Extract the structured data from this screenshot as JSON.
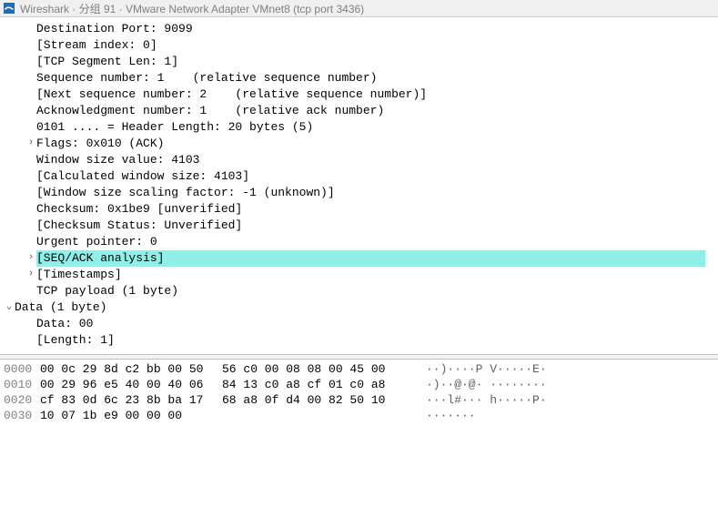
{
  "titlebar": {
    "text": "Wireshark · 分组 91 · VMware Network Adapter VMnet8 (tcp port 3436)"
  },
  "details": {
    "dst_port": "Destination Port: 9099",
    "stream_index": "[Stream index: 0]",
    "tcp_seg_len": "[TCP Segment Len: 1]",
    "seq_num": "Sequence number: 1    (relative sequence number)",
    "next_seq": "[Next sequence number: 2    (relative sequence number)]",
    "ack_num": "Acknowledgment number: 1    (relative ack number)",
    "hdr_len": "0101 .... = Header Length: 20 bytes (5)",
    "flags": "Flags: 0x010 (ACK)",
    "win_size": "Window size value: 4103",
    "calc_win": "[Calculated window size: 4103]",
    "win_scale": "[Window size scaling factor: -1 (unknown)]",
    "checksum": "Checksum: 0x1be9 [unverified]",
    "chk_status": "[Checksum Status: Unverified]",
    "urg_ptr": "Urgent pointer: 0",
    "seq_ack": "[SEQ/ACK analysis]",
    "timestamps": "[Timestamps]",
    "tcp_payload": "TCP payload (1 byte)",
    "data_header": "Data (1 byte)",
    "data_bytes": "Data: 00",
    "data_len": "[Length: 1]"
  },
  "hex": {
    "rows": [
      {
        "off": "0000",
        "b1": "00 0c 29 8d c2 bb 00 50",
        "b2": "56 c0 00 08 08 00 45 00",
        "asc": "··)····P V·····E·"
      },
      {
        "off": "0010",
        "b1": "00 29 96 e5 40 00 40 06",
        "b2": "84 13 c0 a8 cf 01 c0 a8",
        "asc": "·)··@·@· ········"
      },
      {
        "off": "0020",
        "b1": "cf 83 0d 6c 23 8b ba 17",
        "b2": "68 a8 0f d4 00 82 50 10",
        "asc": "···l#··· h·····P·"
      },
      {
        "off": "0030",
        "b1": "10 07 1b e9 00 00 00",
        "b2": "",
        "asc": "·······"
      }
    ]
  }
}
